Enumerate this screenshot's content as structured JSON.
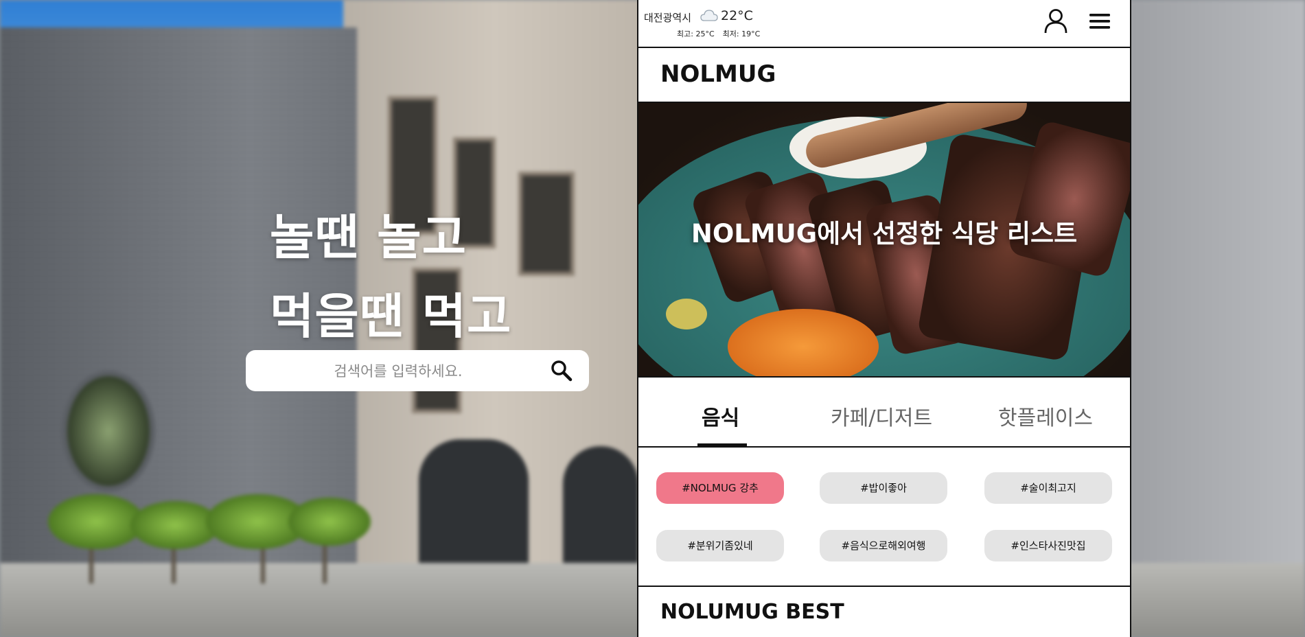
{
  "hero": {
    "line1": "놀땐 놀고",
    "line2": "먹을땐 먹고"
  },
  "search": {
    "placeholder": "검색어를 입력하세요.",
    "icon": "search-icon"
  },
  "topbar": {
    "city": "대전광역시",
    "weather_icon": "cloud-icon",
    "temperature": "22°C",
    "high": "최고: 25°C",
    "low": "최저: 19°C"
  },
  "brand": "NOLMUG",
  "banner": {
    "title": "NOLMUG에서 선정한 식당 리스트"
  },
  "tabs": [
    {
      "label": "음식",
      "active": true
    },
    {
      "label": "카페/디저트",
      "active": false
    },
    {
      "label": "핫플레이스",
      "active": false
    }
  ],
  "tags": [
    {
      "label": "#NOLMUG 강추",
      "highlighted": true
    },
    {
      "label": "#밥이좋아",
      "highlighted": false
    },
    {
      "label": "#술이최고지",
      "highlighted": false
    },
    {
      "label": "#분위기좀있네",
      "highlighted": false
    },
    {
      "label": "#음식으로해외여행",
      "highlighted": false
    },
    {
      "label": "#인스타사진맛집",
      "highlighted": false
    }
  ],
  "colors": {
    "highlight_tag": "#f0788a",
    "tag": "#e4e4e4"
  },
  "best_section": {
    "title": "NOLUMUG BEST"
  }
}
